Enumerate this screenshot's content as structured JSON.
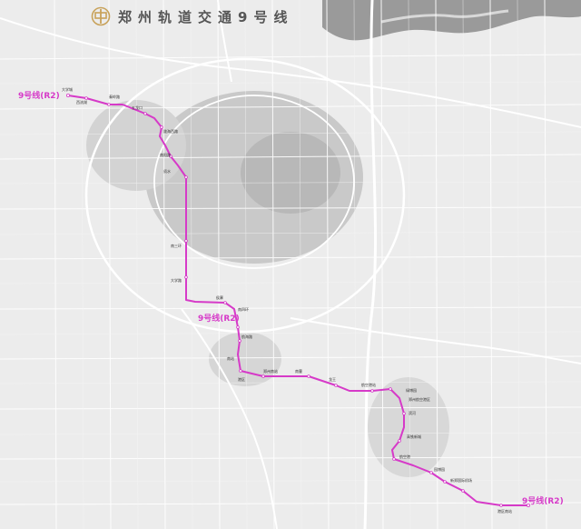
{
  "header": {
    "title": "郑州轨道交通9号线"
  },
  "colors": {
    "line": "#d63ac8",
    "river": "#9a9a9a",
    "road": "#ffffff",
    "dense_area": "#b8b8b8",
    "logo": "#c8a25a"
  },
  "line_labels": {
    "west": "9号线(R2)",
    "middle": "9号线(R2)",
    "east": "9号线(R2)"
  },
  "stations": [
    "大学城",
    "西流湖",
    "秦岭路",
    "五龙口",
    "陇海西路",
    "南阳路",
    "须水",
    "南三环",
    "大学路",
    "侯寨",
    "南四环",
    "航海路",
    "南站",
    "港区",
    "郑州南站",
    "南曹",
    "龙王",
    "航空港站",
    "绿博园",
    "郑州航空港区",
    "滨河",
    "高铁新城",
    "航空港",
    "园博园",
    "新郑国际机场",
    "港区南站"
  ]
}
